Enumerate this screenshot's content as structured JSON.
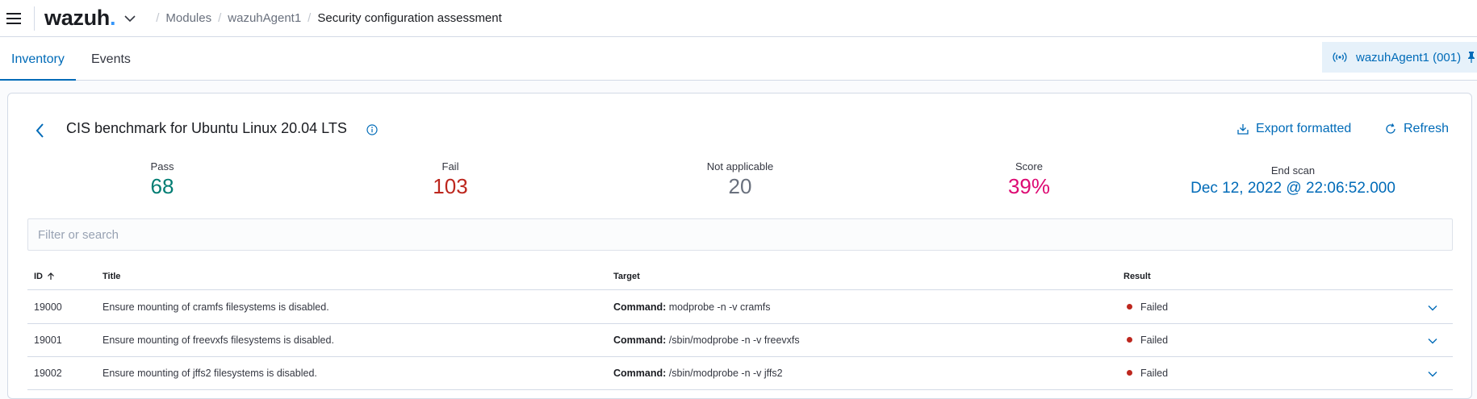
{
  "header": {
    "logo_text": "wazuh",
    "logo_dot": ".",
    "breadcrumbs": [
      {
        "label": "Modules"
      },
      {
        "label": "wazuhAgent1"
      },
      {
        "label": "Security configuration assessment"
      }
    ]
  },
  "tabs": [
    {
      "label": "Inventory",
      "active": true
    },
    {
      "label": "Events",
      "active": false
    }
  ],
  "agent": {
    "label": "wazuhAgent1 (001)"
  },
  "panel": {
    "title": "CIS benchmark for Ubuntu Linux 20.04 LTS",
    "export_label": "Export formatted",
    "refresh_label": "Refresh"
  },
  "stats": {
    "pass": {
      "label": "Pass",
      "value": "68",
      "color": "#017d73"
    },
    "fail": {
      "label": "Fail",
      "value": "103",
      "color": "#bd271e"
    },
    "na": {
      "label": "Not applicable",
      "value": "20",
      "color": "#69707d"
    },
    "score": {
      "label": "Score",
      "value": "39%",
      "color": "#dd0a73"
    },
    "endscan": {
      "label": "End scan",
      "value": "Dec 12, 2022 @ 22:06:52.000"
    }
  },
  "search": {
    "placeholder": "Filter or search"
  },
  "table": {
    "columns": {
      "id": "ID",
      "title": "Title",
      "target": "Target",
      "result": "Result"
    },
    "target_prefix": "Command:",
    "rows": [
      {
        "id": "19000",
        "title": "Ensure mounting of cramfs filesystems is disabled.",
        "target": "modprobe -n -v cramfs",
        "result": "Failed"
      },
      {
        "id": "19001",
        "title": "Ensure mounting of freevxfs filesystems is disabled.",
        "target": "/sbin/modprobe -n -v freevxfs",
        "result": "Failed"
      },
      {
        "id": "19002",
        "title": "Ensure mounting of jffs2 filesystems is disabled.",
        "target": "/sbin/modprobe -n -v jffs2",
        "result": "Failed"
      }
    ],
    "failed_color": "#bd271e"
  }
}
